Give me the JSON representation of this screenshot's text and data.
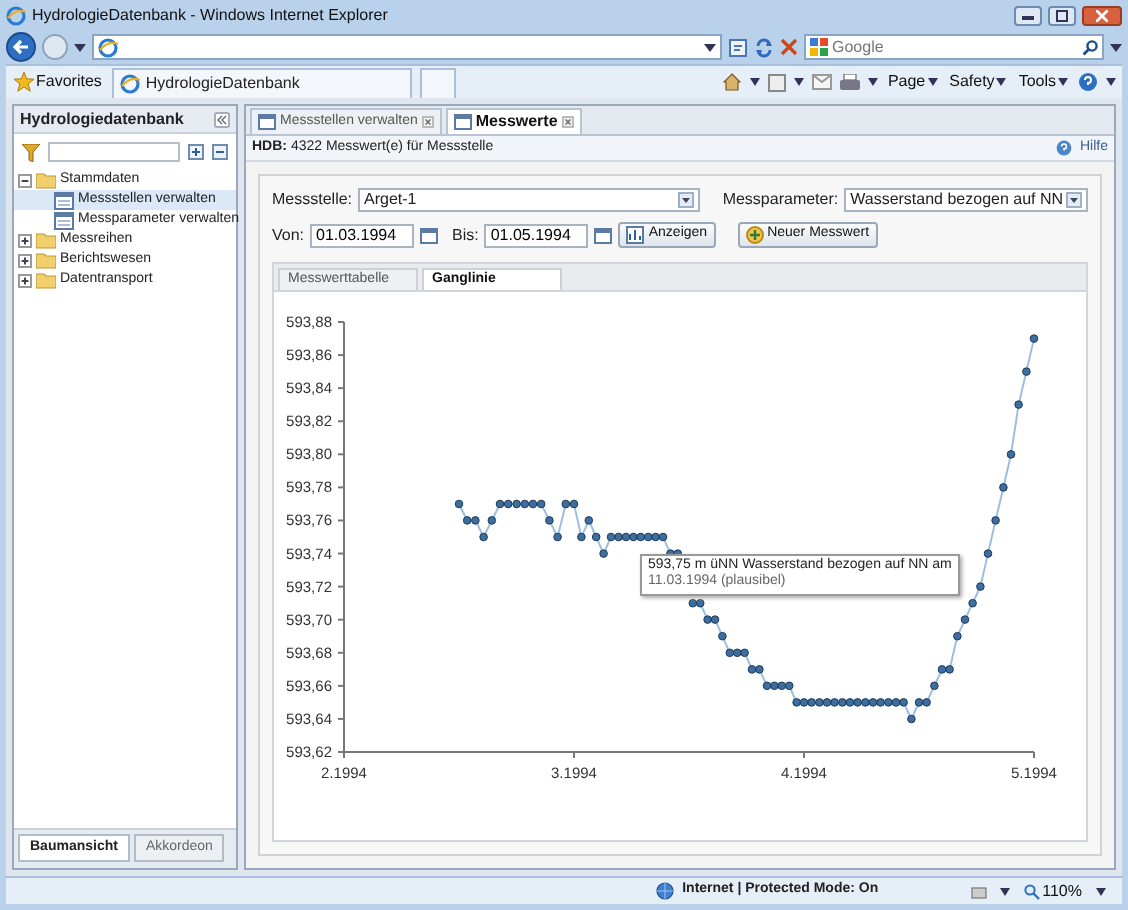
{
  "browser": {
    "title": "HydrologieDatenbank - Windows Internet Explorer",
    "search_placeholder": "Google",
    "favorites": "Favorites",
    "tab": "HydrologieDatenbank",
    "commands": [
      "Page",
      "Safety",
      "Tools"
    ],
    "status": "Internet | Protected Mode: On",
    "zoom": "110%"
  },
  "sidebar": {
    "title": "Hydrologiedatenbank",
    "tree": [
      {
        "label": "Stammdaten",
        "expanded": true,
        "selected": false,
        "children": [
          {
            "label": "Messstellen verwalten",
            "selected": true
          },
          {
            "label": "Messparameter verwalten",
            "selected": false
          }
        ]
      },
      {
        "label": "Messreihen",
        "expanded": false,
        "selected": false
      },
      {
        "label": "Berichtswesen",
        "expanded": false,
        "selected": false
      },
      {
        "label": "Datentransport",
        "expanded": false,
        "selected": false
      }
    ],
    "bottom_tabs": [
      {
        "label": "Baumansicht",
        "selected": true
      },
      {
        "label": "Akkordeon",
        "selected": false
      }
    ]
  },
  "tabs": [
    {
      "label": "Messstellen verwalten",
      "selected": false
    },
    {
      "label": "Messwerte",
      "selected": true
    }
  ],
  "info": {
    "text": "**HDB:** 4322 Messwert(e) für Messstelle",
    "help": "Hilfe"
  },
  "form": {
    "station_label": "Messstelle:",
    "station": "Arget-1",
    "parameter_label": "Messparameter:",
    "parameter": "Wasserstand bezogen auf NN",
    "from_label": "Von:",
    "from": "01.03.1994",
    "to_label": "Bis:",
    "to": "01.05.1994",
    "buttons": [
      "Anzeigen",
      "Neuer Messwert"
    ]
  },
  "subtabs": [
    {
      "label": "Messwerttabelle",
      "selected": false
    },
    {
      "label": "Ganglinie",
      "selected": true
    }
  ],
  "chart": {
    "tooltip": [
      "593,75 m üNN Wasserstand bezogen auf NN am",
      "11.03.1994 (plausibel)"
    ],
    "chart_data": {
      "type": "line",
      "xlim": [
        2.1994,
        5.1994
      ],
      "ylim": [
        593.62,
        593.88
      ],
      "xticks": [
        {
          "value": 2.1994,
          "label": "2.1994"
        },
        {
          "value": 3.1994,
          "label": "3.1994"
        },
        {
          "value": 4.1994,
          "label": "4.1994"
        },
        {
          "value": 5.1994,
          "label": "5.1994"
        }
      ],
      "yticks": [
        {
          "value": 593.88,
          "label": "593,88"
        },
        {
          "value": 593.86,
          "label": "593,86"
        },
        {
          "value": 593.84,
          "label": "593,84"
        },
        {
          "value": 593.82,
          "label": "593,82"
        },
        {
          "value": 593.8,
          "label": "593,80"
        },
        {
          "value": 593.78,
          "label": "593,78"
        },
        {
          "value": 593.76,
          "label": "593,76"
        },
        {
          "value": 593.74,
          "label": "593,74"
        },
        {
          "value": 593.72,
          "label": "593,72"
        },
        {
          "value": 593.7,
          "label": "593,70"
        },
        {
          "value": 593.68,
          "label": "593,68"
        },
        {
          "value": 593.66,
          "label": "593,66"
        },
        {
          "value": 593.64,
          "label": "593,64"
        },
        {
          "value": 593.62,
          "label": "593,62"
        }
      ],
      "x": [
        2.6994,
        2.7351,
        2.7709,
        2.8066,
        2.8423,
        2.878,
        2.9137,
        2.9494,
        2.9851,
        3.0209,
        3.0566,
        3.0923,
        3.128,
        3.1637,
        3.1994,
        3.2317,
        3.2639,
        3.2962,
        3.3284,
        3.3607,
        3.3929,
        3.4252,
        3.4575,
        3.4897,
        3.522,
        3.5542,
        3.5865,
        3.6188,
        3.651,
        3.6833,
        3.7155,
        3.7478,
        3.78,
        3.8123,
        3.8446,
        3.8768,
        3.9091,
        3.9413,
        3.9736,
        4.0059,
        4.0381,
        4.0704,
        4.1026,
        4.1349,
        4.1671,
        4.1994,
        4.2327,
        4.2661,
        4.2994,
        4.3327,
        4.3661,
        4.3994,
        4.4327,
        4.4661,
        4.4994,
        4.5327,
        4.5661,
        4.5994,
        4.6327,
        4.6661,
        4.6994,
        4.7327,
        4.7661,
        4.7994,
        4.8327,
        4.8661,
        4.8994,
        4.9327,
        4.9661,
        4.9994,
        5.0327,
        5.0661,
        5.0994,
        5.1327,
        5.1661,
        5.1994
      ],
      "series": [
        {
          "color": "#3d6e9e",
          "marker": true,
          "values": [
            593.77,
            593.76,
            593.76,
            593.75,
            593.76,
            593.77,
            593.77,
            593.77,
            593.77,
            593.77,
            593.77,
            593.76,
            593.75,
            593.77,
            593.77,
            593.75,
            593.76,
            593.75,
            593.74,
            593.75,
            593.75,
            593.75,
            593.75,
            593.75,
            593.75,
            593.75,
            593.75,
            593.74,
            593.74,
            null,
            593.71,
            593.71,
            593.7,
            593.7,
            593.69,
            593.68,
            593.68,
            593.68,
            593.67,
            593.67,
            593.66,
            593.66,
            593.66,
            593.66,
            593.65,
            593.65,
            593.65,
            593.65,
            593.65,
            593.65,
            593.65,
            593.65,
            593.65,
            593.65,
            593.65,
            593.65,
            593.65,
            593.65,
            593.65,
            593.64,
            593.65,
            593.65,
            593.66,
            593.67,
            593.67,
            593.69,
            593.7,
            593.71,
            593.72,
            593.74,
            593.76,
            593.78,
            593.8,
            593.83,
            593.85,
            593.87
          ]
        }
      ]
    }
  }
}
